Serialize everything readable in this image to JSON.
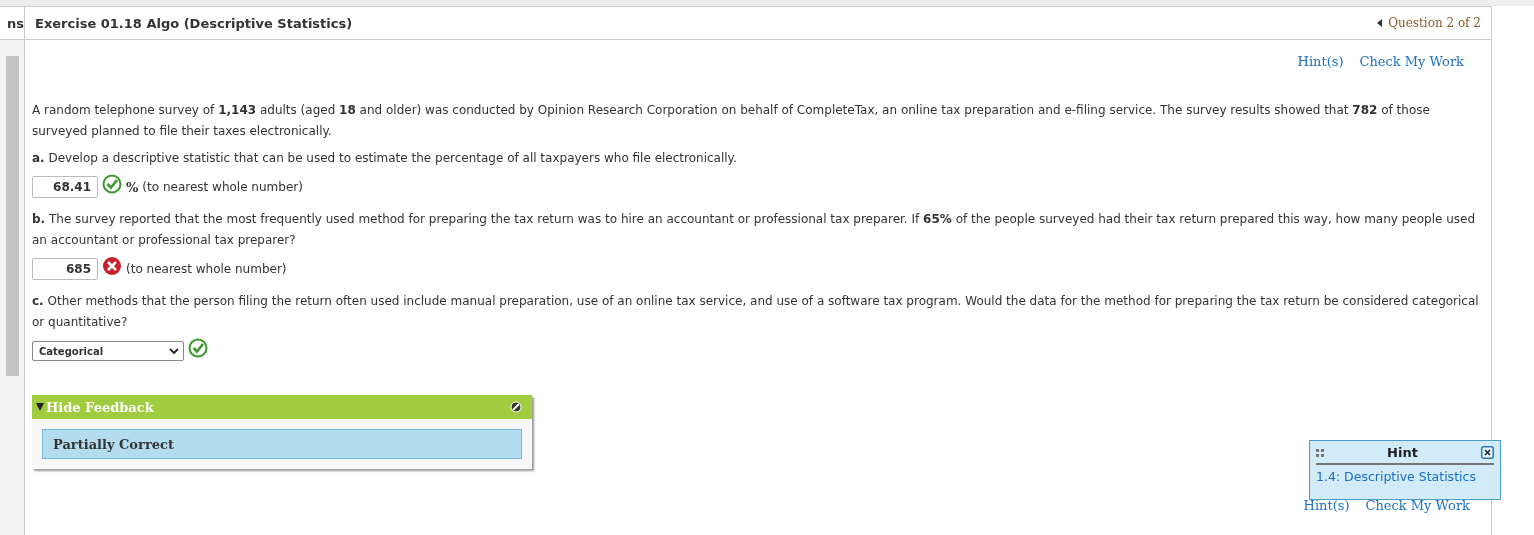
{
  "sidebar": {
    "header": "ns"
  },
  "header": {
    "title": "Exercise 01.18 Algo (Descriptive Statistics)",
    "nav": "Question 2 of 2"
  },
  "top_links": [
    "Hint(s)",
    "Check My Work"
  ],
  "intro": "A random telephone survey of **1,143** adults (aged **18** and older) was conducted by Opinion Research Corporation on behalf of CompleteTax, an online tax preparation and e-filing service. The survey results showed that **782** of those surveyed planned to file their taxes electronically.",
  "parts": [
    {
      "kind": "number",
      "letter": "a.",
      "question": "Develop a descriptive statistic that can be used to estimate the percentage of all taxpayers who file electronically.",
      "value": "68.41",
      "correct": true,
      "unit": "%",
      "note": "(to nearest whole number)"
    },
    {
      "kind": "number",
      "letter": "b.",
      "question": "The survey reported that the most frequently used method for preparing the tax return was to hire an accountant or professional tax preparer. If **65%** of the people surveyed had their tax return prepared this way, how many people used an accountant or professional tax preparer?",
      "value": "685",
      "correct": false,
      "note": "(to nearest whole number)"
    },
    {
      "kind": "select",
      "letter": "c.",
      "question": "Other methods that the person filing the return often used include manual preparation, use of an online tax service, and use of a software tax program. Would the data for the method for preparing the tax return be considered categorical or quantitative?",
      "value": "Categorical",
      "correct": true
    }
  ],
  "feedback": {
    "toggle": "Hide Feedback",
    "expanded": true,
    "result": "Partially Correct"
  },
  "hint_popup": {
    "title": "Hint",
    "link": "1.4: Descriptive Statistics"
  },
  "bottom_links": [
    "Hint(s)",
    "Check My Work"
  ]
}
